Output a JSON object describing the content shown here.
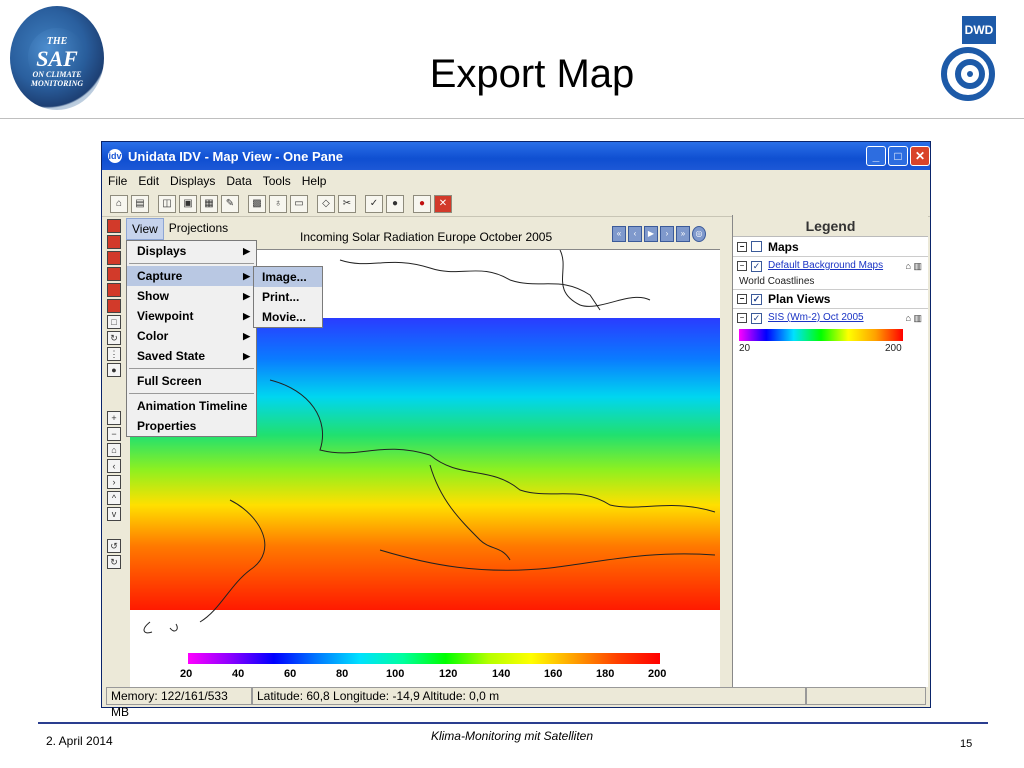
{
  "slide": {
    "title": "Export Map",
    "footer_date": "2. April 2014",
    "footer_center": "Klima-Monitoring mit Satelliten",
    "page_number": "15",
    "logo_left": {
      "line1": "THE",
      "line2": "SAF",
      "line3": "ON CLIMATE MONITORING"
    },
    "logo_right": "DWD"
  },
  "window": {
    "title": "Unidata IDV - Map View - One Pane",
    "menu": [
      "File",
      "Edit",
      "Displays",
      "Data",
      "Tools",
      "Help"
    ],
    "view_tabs": [
      "View",
      "Projections"
    ],
    "map_title": "Incoming Solar Radiation Europe October 2005",
    "view_menu": {
      "items": [
        {
          "label": "Displays",
          "submenu": true
        },
        {
          "label": "Capture",
          "submenu": true
        },
        {
          "label": "Show",
          "submenu": true
        },
        {
          "label": "Viewpoint",
          "submenu": true
        },
        {
          "label": "Color",
          "submenu": true
        },
        {
          "label": "Saved State",
          "submenu": true
        },
        {
          "label": "Full Screen",
          "submenu": false
        },
        {
          "label": "Animation Timeline",
          "submenu": false
        },
        {
          "label": "Properties",
          "submenu": false
        }
      ],
      "capture_submenu": [
        "Image...",
        "Print...",
        "Movie..."
      ]
    },
    "colorbar_labels": [
      "20",
      "40",
      "60",
      "80",
      "100",
      "120",
      "140",
      "160",
      "180",
      "200"
    ],
    "legend": {
      "title": "Legend",
      "maps_label": "Maps",
      "maps_item": "Default Background Maps",
      "maps_sub": "World Coastlines",
      "plan_label": "Plan Views",
      "plan_item": "SIS (Wm-2) Oct 2005",
      "range_min": "20",
      "range_max": "200"
    },
    "status": {
      "memory": "Memory: 122/161/533 MB",
      "position": "Latitude:   60,8 Longitude:  -14,9 Altitude:    0,0 m"
    },
    "colors": {
      "titlebar": "#0f4fd1",
      "menu_highlight": "#b9c8e3",
      "link": "#1a33c4"
    }
  }
}
